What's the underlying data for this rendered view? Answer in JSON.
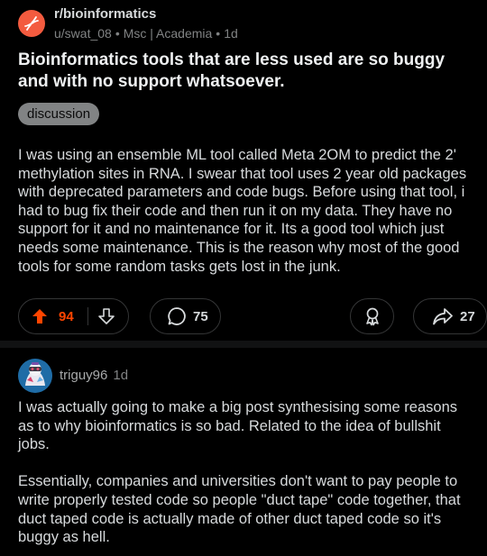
{
  "post": {
    "subreddit": "r/bioinformatics",
    "author": "u/swat_08",
    "author_flair": "Msc | Academia",
    "age": "1d",
    "separator": "•",
    "title": "Bioinformatics tools that are less used are so buggy and with no support whatsoever.",
    "flair": "discussion",
    "body": "I was using an ensemble ML tool called Meta 2OM to predict the 2' methylation sites in RNA. I swear that tool uses 2 year old packages with deprecated parameters and code bugs. Before using that tool, i had to bug fix their code and then run it on my data. They have no support for it and no maintenance for it. Its a good tool which just needs some maintenance. This is the reason why most of the good tools for some random tasks gets lost in the junk.",
    "score": "94",
    "comments": "75",
    "shares": "27"
  },
  "icons": {
    "subreddit": "dna-icon",
    "upvote": "upvote-arrow-icon",
    "downvote": "downvote-arrow-icon",
    "comment": "comment-bubble-icon",
    "award": "award-icon",
    "share": "share-arrow-icon"
  },
  "colors": {
    "background": "#000000",
    "accent_upvote": "#ff4500",
    "subreddit_icon_bg": "#f35b3f",
    "muted_text": "#818384",
    "flair_bg": "#818384"
  },
  "comment": {
    "author": "triguy96",
    "age": "1d",
    "paragraphs": [
      "I was actually going to make a big post synthesising some reasons as to why bioinformatics is so bad. Related to the idea of bullshit jobs.",
      "Essentially, companies and universities don't want to pay people to write properly tested code so people \"duct tape\" code together, that duct taped code is actually made of other duct taped code so it's buggy as hell."
    ]
  }
}
